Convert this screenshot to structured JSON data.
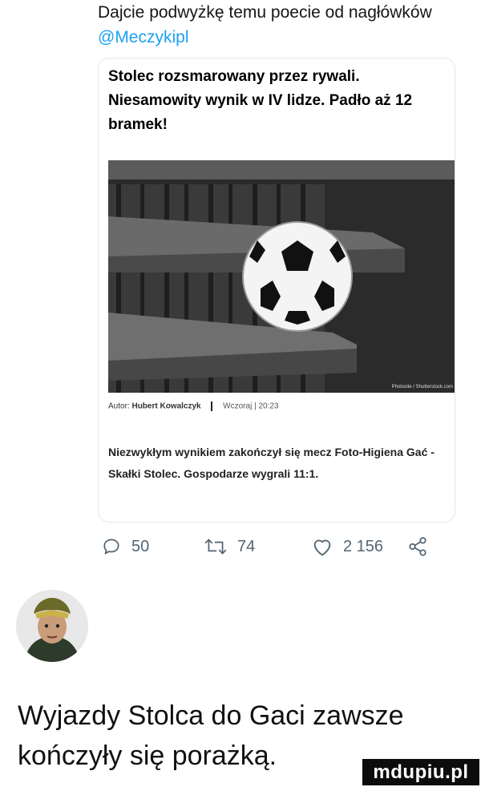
{
  "tweet": {
    "text_before": "Dajcie podwyżkę temu poecie od nagłówków ",
    "mention": "@Meczykipl"
  },
  "article": {
    "headline": "Stolec rozsmarowany przez rywali. Niesamowity wynik w IV lidze. Padło aż 12 bramek!",
    "photo_credit": "Photosite / Shutterstock.com",
    "author_label": "Autor:",
    "author_name": "Hubert Kowalczyk",
    "date": "Wczoraj | 20:23",
    "lead": "Niezwykłym wynikiem zakończył się mecz Foto-Higiena Gać - Skałki Stolec. Gospodarze wygrali 11:1."
  },
  "actions": {
    "replies": "50",
    "retweets": "74",
    "likes": "2 156"
  },
  "caption": "Wyjazdy Stolca do Gaci zawsze kończyły się porażką.",
  "watermark": "mdupiu.pl",
  "icons": [
    "reply-icon",
    "retweet-icon",
    "like-icon",
    "share-icon"
  ],
  "colors": {
    "mention": "#1da1f2",
    "icon_gray": "#536471"
  }
}
